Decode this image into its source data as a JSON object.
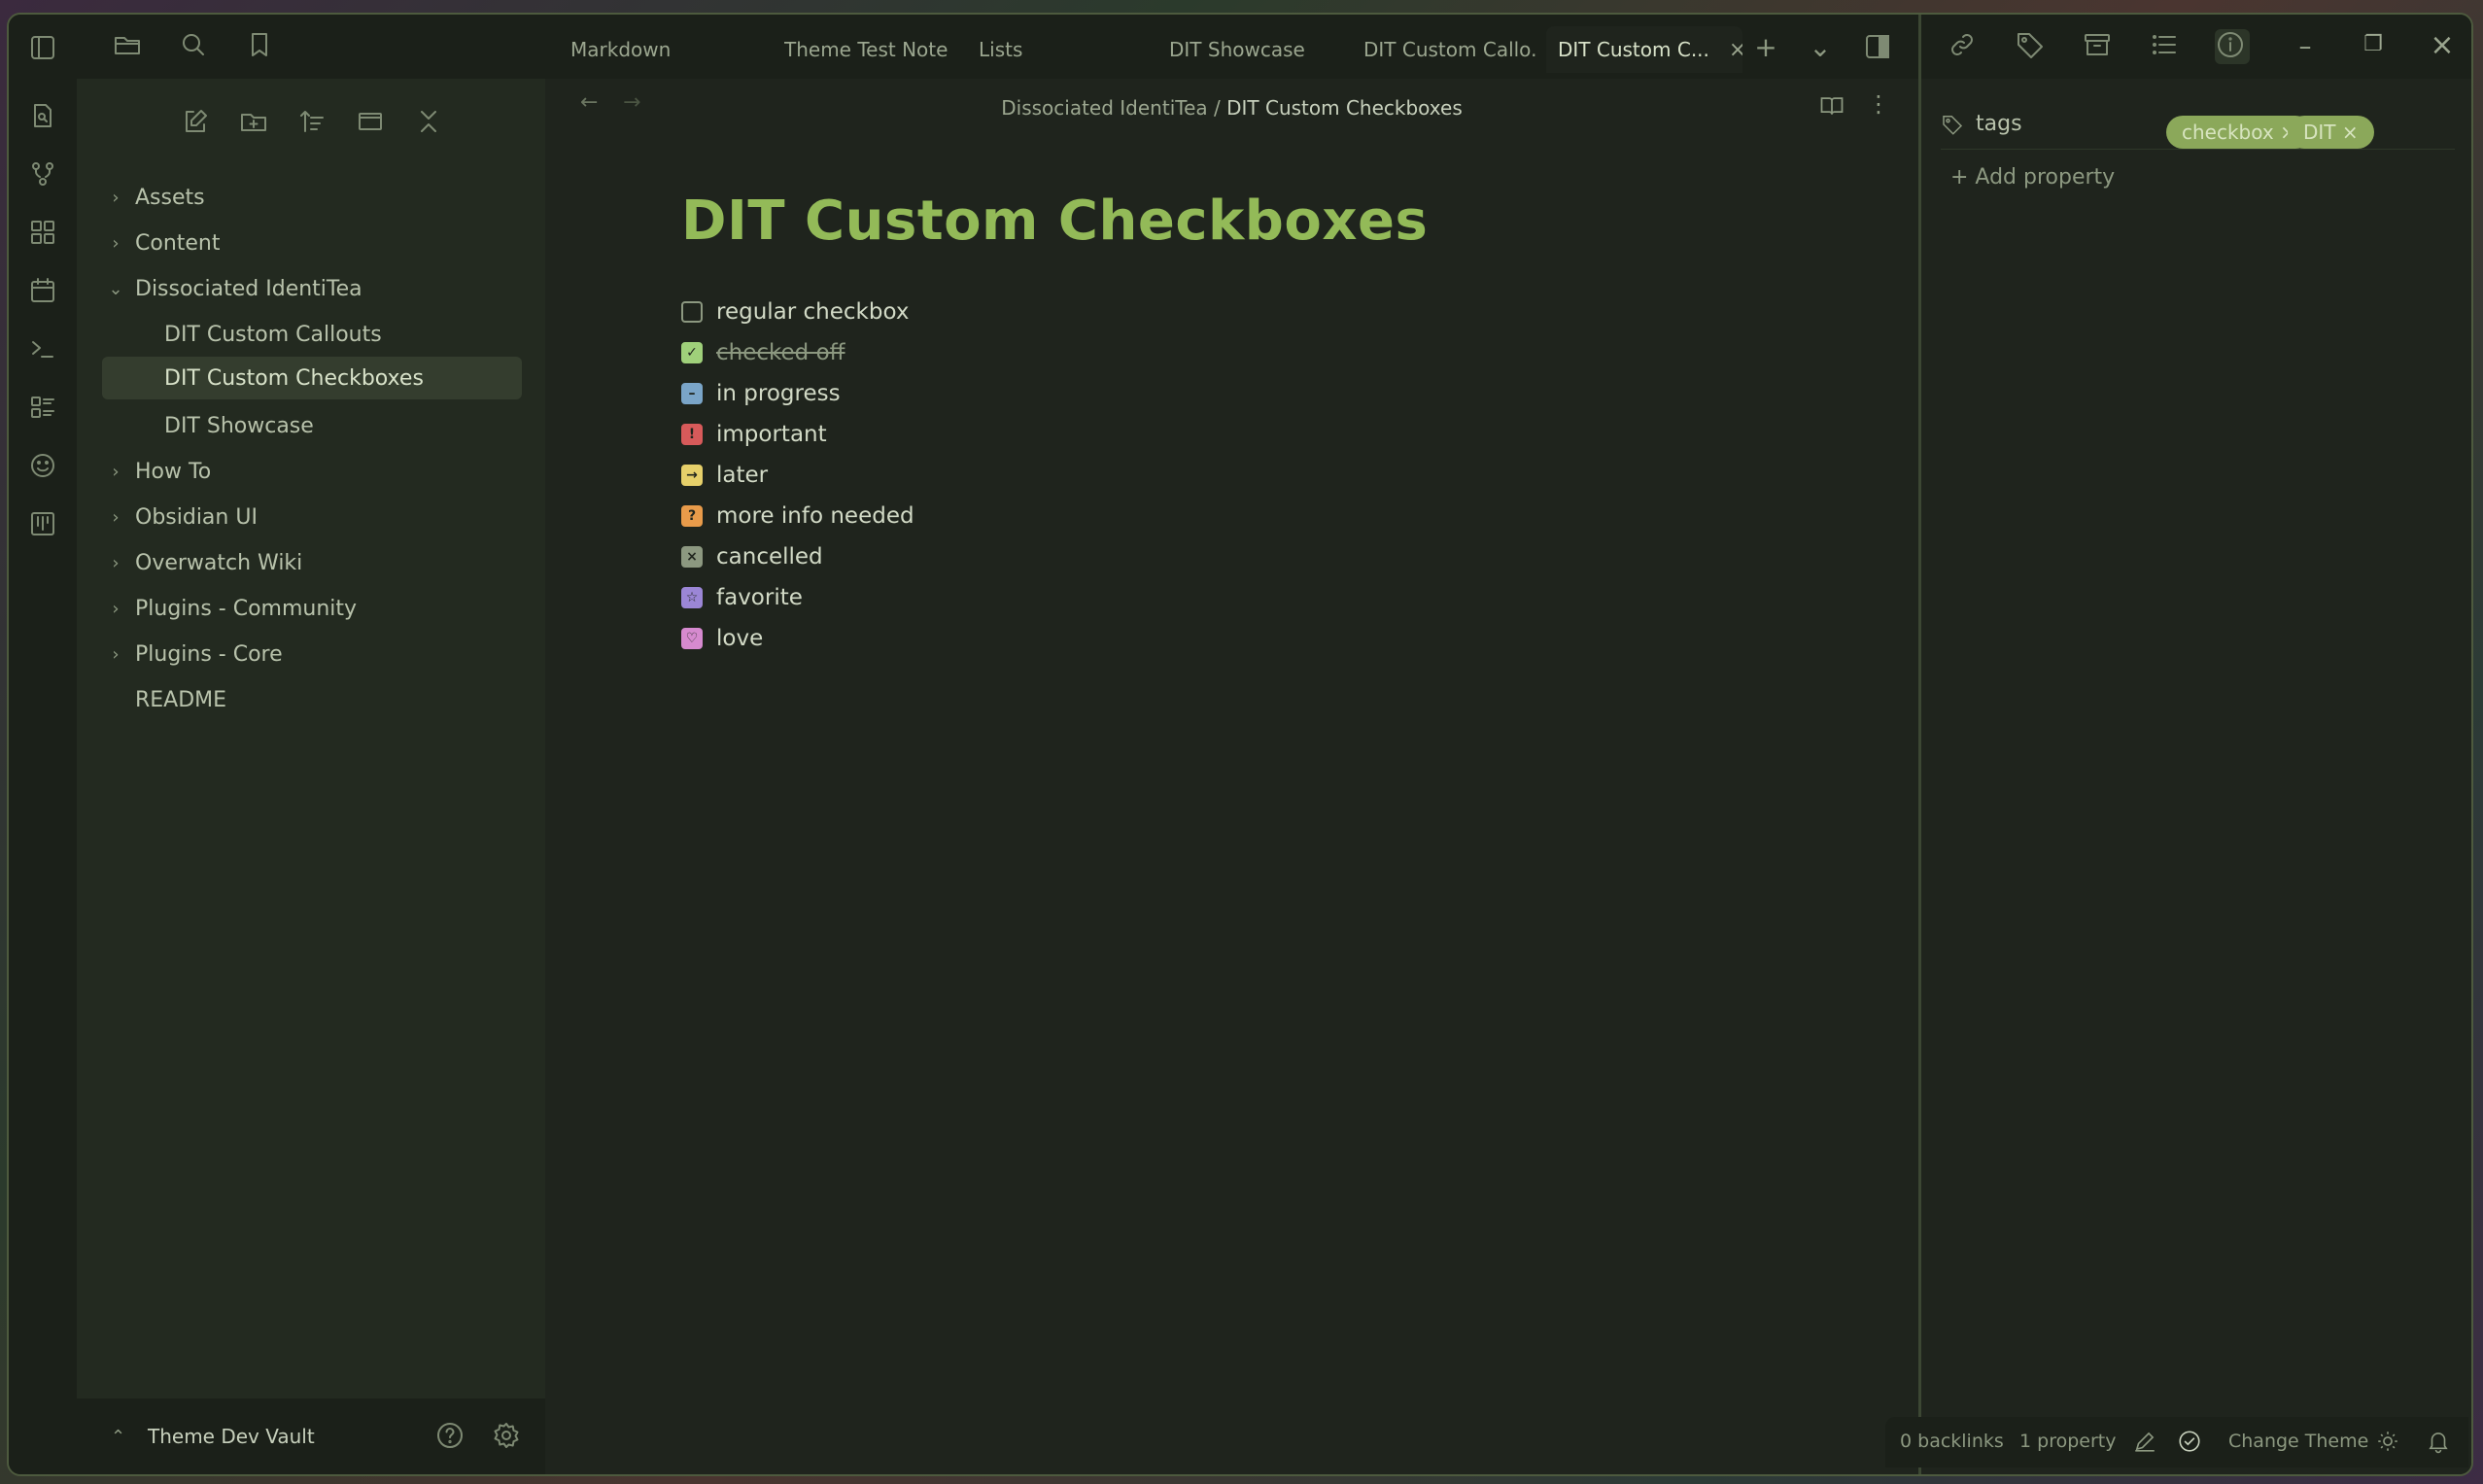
{
  "sidebar": {
    "tree": [
      {
        "label": "Assets",
        "chevron": "›"
      },
      {
        "label": "Content",
        "chevron": "›"
      },
      {
        "label": "Dissociated IdentiTea",
        "chevron": "⌄"
      },
      {
        "label": "DIT Custom Callouts"
      },
      {
        "label": "DIT Custom Checkboxes"
      },
      {
        "label": "DIT Showcase"
      },
      {
        "label": "How To",
        "chevron": "›"
      },
      {
        "label": "Obsidian UI",
        "chevron": "›"
      },
      {
        "label": "Overwatch Wiki",
        "chevron": "›"
      },
      {
        "label": "Plugins - Community",
        "chevron": "›"
      },
      {
        "label": "Plugins - Core",
        "chevron": "›"
      },
      {
        "label": "README"
      }
    ],
    "vault_name": "Theme Dev Vault",
    "vault_chevron": "⌃"
  },
  "tabs": [
    {
      "label": "Markdown"
    },
    {
      "label": "Theme Test Note"
    },
    {
      "label": "Lists"
    },
    {
      "label": "DIT Showcase"
    },
    {
      "label": "DIT Custom Callo..."
    },
    {
      "label": "DIT Custom C...",
      "close": "×"
    }
  ],
  "tabbar": {
    "new_tab": "+",
    "tab_list": "⌄"
  },
  "nav": {
    "back": "←",
    "forward": "→"
  },
  "breadcrumb": {
    "parent": "Dissociated IdentiTea",
    "separator": "/",
    "current": "DIT Custom Checkboxes"
  },
  "note": {
    "title": "DIT Custom Checkboxes",
    "tasks": [
      {
        "label": "regular checkbox",
        "mark": "",
        "color": "#1f241d",
        "border": "#8c9880"
      },
      {
        "label": "checked off",
        "mark": "✓",
        "color": "#9fd07a",
        "border": "#9fd07a"
      },
      {
        "label": "in progress",
        "mark": "–",
        "color": "#7aa5c8",
        "border": "#7aa5c8"
      },
      {
        "label": "important",
        "mark": "!",
        "color": "#d75a5a",
        "border": "#d75a5a"
      },
      {
        "label": "later",
        "mark": "→",
        "color": "#e6d06a",
        "border": "#e6d06a"
      },
      {
        "label": "more info needed",
        "mark": "?",
        "color": "#e89b4a",
        "border": "#e89b4a"
      },
      {
        "label": "cancelled",
        "mark": "×",
        "color": "#8c9880",
        "border": "#8c9880"
      },
      {
        "label": "favorite",
        "mark": "☆",
        "color": "#9b86d6",
        "border": "#9b86d6"
      },
      {
        "label": "love",
        "mark": "♡",
        "color": "#d68acf",
        "border": "#d68acf"
      }
    ]
  },
  "properties": {
    "key": "tags",
    "tags": [
      {
        "label": "checkbox ×"
      },
      {
        "label": "DIT ×"
      }
    ],
    "add_label": "+ Add property"
  },
  "window_controls": {
    "minimize": "–",
    "restore": "❐",
    "close": "×"
  },
  "status": {
    "backlinks": "0 backlinks",
    "properties": "1 property",
    "theme": "Change Theme"
  },
  "colors": {
    "accent": "#93ba58",
    "background": "#1f241d",
    "tag_pill": "#8ba85a"
  }
}
